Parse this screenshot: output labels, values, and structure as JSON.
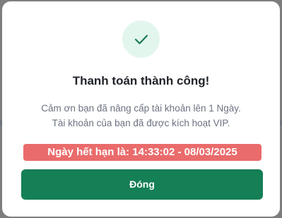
{
  "dialog": {
    "icon": "check-icon",
    "title": "Thanh toán thành công!",
    "message_line1": "Cảm ơn bạn đã nâng cấp tài khoản lên 1 Ngày.",
    "message_line2": "Tài khoản của bạn đã được kích hoạt VIP.",
    "expiry_text": "Ngày hết hạn là: 14:33:02 - 08/03/2025",
    "close_label": "Đóng"
  },
  "colors": {
    "accent_green": "#157f56",
    "check_circle_bg": "#e3f6ee",
    "expiry_bg": "#ea6b6b"
  }
}
